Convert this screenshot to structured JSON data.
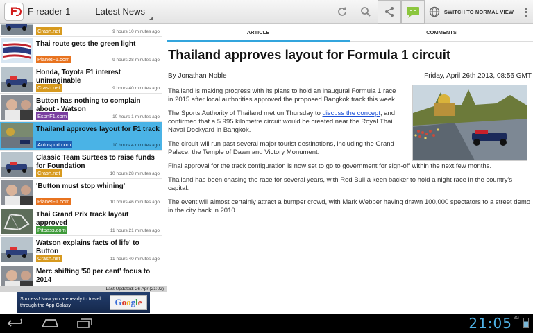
{
  "app": {
    "title": "F-reader-1",
    "section_label": "Latest News",
    "switch_view_label": "SWITCH TO NORMAL VIEW",
    "icons": [
      "refresh-icon",
      "search-icon",
      "share-icon",
      "android-icon",
      "globe-icon",
      "overflow-menu-icon"
    ]
  },
  "tabs": [
    {
      "label": "ARTICLE",
      "active": true
    },
    {
      "label": "COMMENTS",
      "active": false
    }
  ],
  "news_list": [
    {
      "title": "",
      "source": "Crash.net",
      "source_color": "#d79a1f",
      "time": "9 hours 10 minutes ago",
      "thumb": "car"
    },
    {
      "title": "Thai route gets the green light",
      "source": "PlanetF1.com",
      "source_color": "#e8731f",
      "time": "9 hours 28 minutes ago",
      "thumb": "flag"
    },
    {
      "title": "Honda, Toyota F1 interest unimaginable",
      "source": "Crash.net",
      "source_color": "#d79a1f",
      "time": "9 hours 40 minutes ago",
      "thumb": "car"
    },
    {
      "title": "Button has nothing to complain about  - Watson",
      "source": "EspnF1.com",
      "source_color": "#7a3fa0",
      "time": "10 hours 1 minutes ago",
      "thumb": "person"
    },
    {
      "title": "Thailand approves layout for F1 track",
      "source": "Autosport.com",
      "source_color": "#1f5fb3",
      "time": "10 hours 4 minutes ago",
      "thumb": "city",
      "selected": true
    },
    {
      "title": "Classic Team Surtees to raise funds for Foundation",
      "source": "Crash.net",
      "source_color": "#d79a1f",
      "time": "10 hours 28 minutes ago",
      "thumb": "car"
    },
    {
      "title": "'Button must stop whining'",
      "source": "PlanetF1.com",
      "source_color": "#e8731f",
      "time": "10 hours 46 minutes ago",
      "thumb": "person"
    },
    {
      "title": "Thai Grand Prix track layout approved",
      "source": "Pitpass.com",
      "source_color": "#3f9b3a",
      "time": "11 hours 21 minutes ago",
      "thumb": "map"
    },
    {
      "title": "Watson explains  facts of life' to Button",
      "source": "Crash.net",
      "source_color": "#d79a1f",
      "time": "11 hours 40 minutes ago",
      "thumb": "car"
    },
    {
      "title": "Merc shifting '50 per cent' focus to 2014",
      "source": "",
      "source_color": "#e8731f",
      "time": "",
      "thumb": "person"
    }
  ],
  "last_updated": "Last Updated: 26 Apr (21:02)",
  "ad": {
    "text": "Success! Now you are ready to travel through the App Galaxy.",
    "brand": "Google",
    "brand_colors": [
      "#3b6fd8",
      "#d83b2d",
      "#f2b01e",
      "#3b6fd8",
      "#2f9a46",
      "#d83b2d"
    ]
  },
  "article": {
    "headline": "Thailand approves layout for Formula 1 circuit",
    "author": "By Jonathan Noble",
    "date": "Friday, April 26th 2013, 08:56 GMT",
    "p1": "Thailand is making progress with its plans to hold an inaugural Formula 1 race in 2015 after local authorities approved the proposed Bangkok track this week.",
    "p2_before": "The Sports Authority of Thailand met on Thursday to ",
    "p2_link": "discuss the concept",
    "p2_after": ", and confirmed that a 5.995 kilometre circuit would be created near the Royal Thai Naval Dockyard in Bangkok.",
    "p3": "The circuit will run past several major tourist destinations, including the Grand Palace, the Temple of Dawn and Victory Monument.",
    "p4": "Final approval for the track configuration is now set to go to government for sign-off within the next few months.",
    "p5": "Thailand has been chasing the race for several years, with Red Bull a keen backer to hold a night race in the country's capital.",
    "p6": "The event will almost certainly attract a bumper crowd, with Mark Webber having drawn 100,000 spectators to a street demo in the city back in 2010."
  },
  "system": {
    "clock": "21:05",
    "signal": "3G",
    "accent": "#4fb2e6"
  }
}
